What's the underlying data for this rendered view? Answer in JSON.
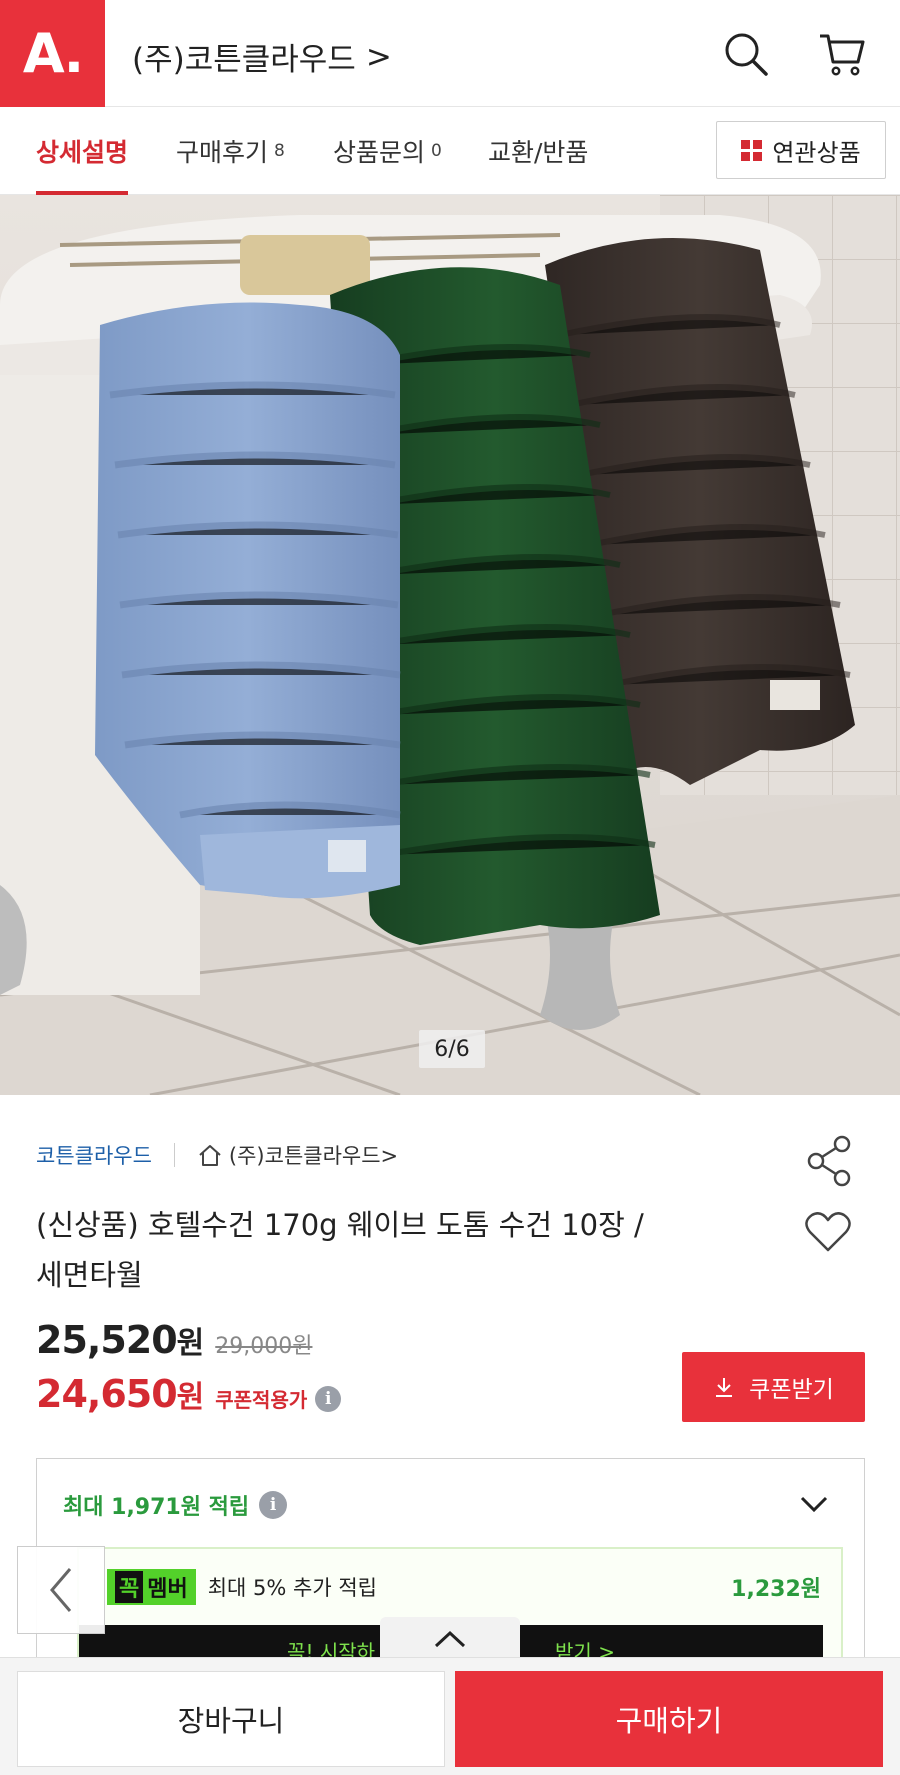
{
  "header": {
    "logo_text": "A.",
    "store_title": "(주)코튼클라우드",
    "title_chevron": ">",
    "search_icon": "search-icon",
    "cart_icon": "cart-icon"
  },
  "tabs": [
    {
      "label": "상세설명",
      "count": "",
      "active": true
    },
    {
      "label": "구매후기",
      "count": "8",
      "active": false
    },
    {
      "label": "상품문의",
      "count": "0",
      "active": false
    },
    {
      "label": "교환/반품",
      "count": "",
      "active": false
    }
  ],
  "related_button": {
    "label": "연관상품",
    "icon": "grid-icon"
  },
  "gallery": {
    "counter": "6/6",
    "subject": "towels-on-bathtub"
  },
  "product": {
    "brand": "코튼클라우드",
    "store_link": "(주)코튼클라우드>",
    "title_line1": "(신상품) 호텔수건 170g 웨이브 도톰 수건 10장 /",
    "title_line2": "세면타월",
    "price": "25,520",
    "price_unit": "원",
    "original_price": "29,000원",
    "coupon_price": "24,650",
    "coupon_price_unit": "원",
    "coupon_label": "쿠폰적용가",
    "coupon_button": "쿠폰받기"
  },
  "points": {
    "header": "최대 1,971원 적립",
    "member_badge_k": "꼭",
    "member_badge": "멤버",
    "member_desc": "최대 5% 추가 적립",
    "member_amount": "1,232원",
    "promo_left": "꼭! 시작하",
    "promo_right": "받기 >"
  },
  "bottom": {
    "cart_label": "장바구니",
    "buy_label": "구매하기"
  },
  "colors": {
    "brand_red": "#e8313b",
    "active_tab": "#d42a32",
    "green": "#2a9a3d",
    "link_blue": "#1d5fa8"
  }
}
